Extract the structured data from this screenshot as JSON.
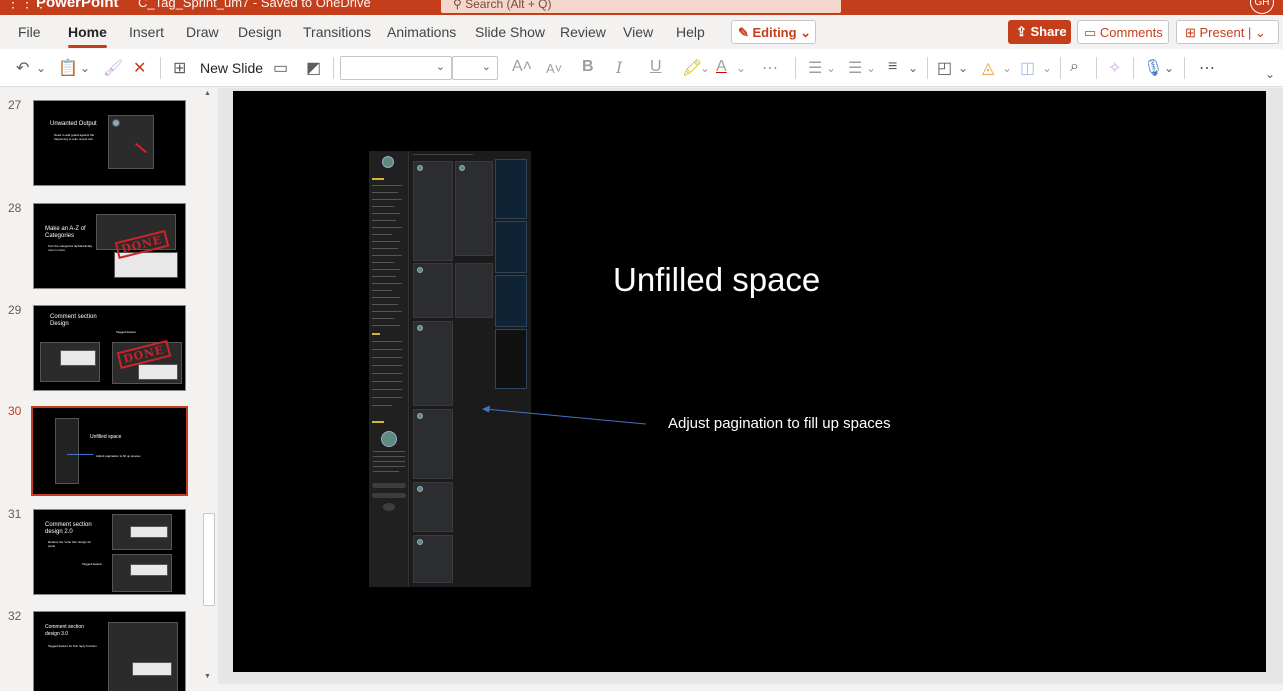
{
  "titlebar": {
    "app_name": "PowerPoint",
    "doc_name": "C_Tag_Sprint_um7 - Saved to OneDrive",
    "search_placeholder": "Search (Alt + Q)",
    "account_initials": "GH"
  },
  "menu": {
    "tabs": [
      "File",
      "Home",
      "Insert",
      "Draw",
      "Design",
      "Transitions",
      "Animations",
      "Slide Show",
      "Review",
      "View",
      "Help"
    ],
    "active_tab": "Home",
    "editing_label": "Editing",
    "share_label": "Share",
    "comments_label": "Comments",
    "present_label": "Present"
  },
  "ribbon": {
    "new_slide_label": "New Slide",
    "font_name": "",
    "font_size": ""
  },
  "thumbnails": [
    {
      "number": "27",
      "title": "Unwanted Output",
      "bullet": "Need to add guard against file happening to auto output cell"
    },
    {
      "number": "28",
      "title": "Make an A-Z of Categories",
      "bullet": "Sort the categories alphabetically now in menu",
      "stamp": "DONE"
    },
    {
      "number": "29",
      "title": "Comment section Design",
      "bullet": "Tagged feature",
      "stamp": "DONE"
    },
    {
      "number": "30",
      "title": "Unfilled space",
      "bullet": "Adjust pagination to fill up spaces",
      "selected": true
    },
    {
      "number": "31",
      "title": "Comment section design 2.0",
      "bullet": "Reduce the 'write this' design for posts",
      "extra": "Tagged feature"
    },
    {
      "number": "32",
      "title": "Comment section design 3.0",
      "bullet": "Tagged feature for first reply function"
    }
  ],
  "slide": {
    "title": "Unfilled space",
    "caption": "Adjust pagination to fill up spaces"
  },
  "colors": {
    "accent": "#c43e1c",
    "slide_bg": "#000000",
    "arrow": "#4472c4"
  }
}
